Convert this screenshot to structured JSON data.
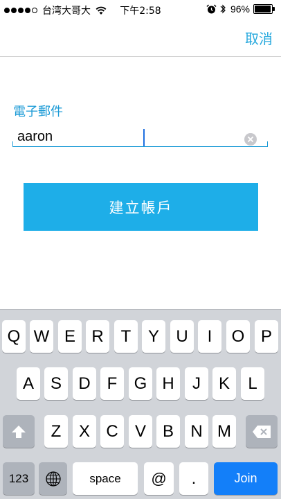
{
  "status_bar": {
    "carrier": "台湾大哥大",
    "time": "下午2:58",
    "battery_text": "96%",
    "battery_level": 0.96,
    "signal_bars_filled": 4,
    "signal_bars_total": 5
  },
  "nav": {
    "cancel_label": "取消"
  },
  "form": {
    "email_label": "電子郵件",
    "email_value": "aaron",
    "create_button_label": "建立帳戶"
  },
  "keyboard": {
    "row1": [
      "Q",
      "W",
      "E",
      "R",
      "T",
      "Y",
      "U",
      "I",
      "O",
      "P"
    ],
    "row2": [
      "A",
      "S",
      "D",
      "F",
      "G",
      "H",
      "J",
      "K",
      "L"
    ],
    "row3": [
      "Z",
      "X",
      "C",
      "V",
      "B",
      "N",
      "M"
    ],
    "numbers_key": "123",
    "space_key": "space",
    "at_key": "@",
    "dot_key": ".",
    "join_key": "Join"
  },
  "colors": {
    "accent": "#1a9ad6",
    "button": "#1eaee8",
    "join": "#137ff9",
    "keyboard_bg": "#d1d4d9"
  }
}
